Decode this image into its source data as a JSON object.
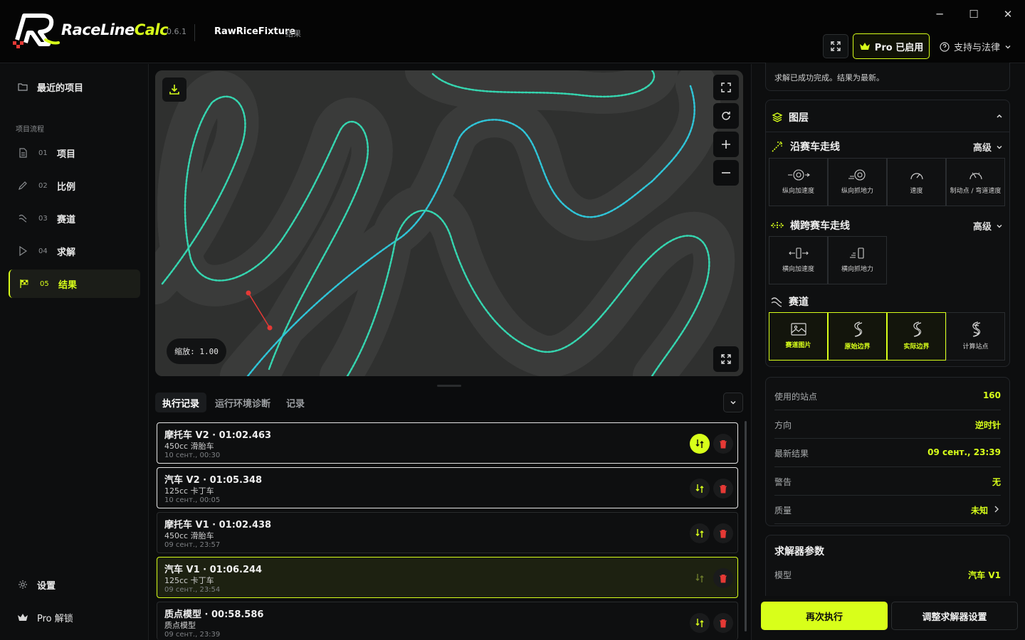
{
  "app": {
    "name_part1": "RaceLine",
    "name_part2": "Calc",
    "version": "0.6.1",
    "project_name": "RawRiceFixture",
    "project_section": "结果"
  },
  "header": {
    "pro_label": "Pro 已启用",
    "support_label": "支持与法律",
    "window_controls": [
      "─",
      "☐",
      "✕"
    ]
  },
  "sidebar": {
    "recent_label": "最近的项目",
    "section_label": "项目流程",
    "steps": [
      {
        "num": "01",
        "label": "项目"
      },
      {
        "num": "02",
        "label": "比例"
      },
      {
        "num": "03",
        "label": "赛道"
      },
      {
        "num": "04",
        "label": "求解"
      },
      {
        "num": "05",
        "label": "结果"
      }
    ],
    "settings_label": "设置",
    "pro_unlock_label": "Pro 解锁"
  },
  "map": {
    "zoom_label": "缩放: 1.00"
  },
  "log": {
    "tabs": [
      "执行记录",
      "运行环境诊断",
      "记录"
    ],
    "runs": [
      {
        "title": "摩托车 V2 · 01:02.463",
        "vehicle": "450cc 滑胎车",
        "time": "10 сент., 00:30"
      },
      {
        "title": "汽车 V2 · 01:05.348",
        "vehicle": "125cc 卡丁车",
        "time": "10 сент., 00:05"
      },
      {
        "title": "摩托车 V1 · 01:02.438",
        "vehicle": "450cc 滑胎车",
        "time": "09 сент., 23:57"
      },
      {
        "title": "汽车 V1 · 01:06.244",
        "vehicle": "125cc 卡丁车",
        "time": "09 сент., 23:54"
      },
      {
        "title": "质点模型 · 00:58.586",
        "vehicle": "质点模型",
        "time": "09 сент., 23:39"
      }
    ]
  },
  "right": {
    "status": "求解已成功完成。结果为最新。",
    "layers_title": "图层",
    "along": {
      "title": "沿赛车走线",
      "advanced": "高级",
      "tiles": [
        "纵向加速度",
        "纵向抓地力",
        "速度",
        "制动点 / 弯道速度"
      ]
    },
    "across": {
      "title": "横跨赛车走线",
      "advanced": "高级",
      "tiles": [
        "横向加速度",
        "横向抓地力"
      ]
    },
    "track": {
      "title": "赛道",
      "tiles": [
        "赛道图片",
        "原始边界",
        "实际边界",
        "计算站点"
      ]
    },
    "stats": [
      {
        "key": "使用的站点",
        "value": "160"
      },
      {
        "key": "方向",
        "value": "逆时针"
      },
      {
        "key": "最新结果",
        "value": "09 сент., 23:39"
      },
      {
        "key": "警告",
        "value": "无"
      },
      {
        "key": "质量",
        "value": "未知"
      }
    ],
    "solver": {
      "title": "求解器参数",
      "model_key": "模型",
      "model_value": "汽车 V1"
    },
    "rerun_label": "再次执行",
    "adjust_label": "调整求解器设置"
  },
  "colors": {
    "accent": "#d8ff1a",
    "background": "#0b0c0d"
  }
}
